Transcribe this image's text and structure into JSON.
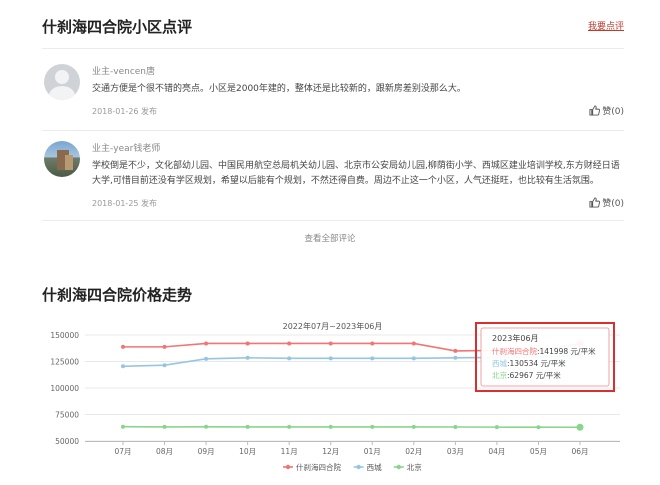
{
  "reviews_section": {
    "title": "什刹海四合院小区点评",
    "write_review_link": "我要点评",
    "reviews": [
      {
        "name": "业主-vencen唐",
        "text": "交通方便是个很不错的亮点。小区是2000年建的，整体还是比较新的，跟新房差别没那么大。",
        "date": "2018-01-26 发布",
        "like_label": "赞(0)"
      },
      {
        "name": "业主-year钱老师",
        "text": "学校倒是不少，文化部幼儿园、中国民用航空总局机关幼儿园、北京市公安局幼儿园,柳荫街小学、西城区建业培训学校,东方财经日语大学,可惜目前还没有学区规划，希望以后能有个规划，不然还得自费。周边不止这一个小区，人气还挺旺，也比较有生活氛围。",
        "date": "2018-01-25 发布",
        "like_label": "赞(0)"
      }
    ],
    "view_all": "查看全部评论"
  },
  "price_section": {
    "title": "什刹海四合院价格走势"
  },
  "chart_data": {
    "type": "line",
    "title": "2022年07月~2023年06月",
    "categories": [
      "07月",
      "08月",
      "09月",
      "10月",
      "11月",
      "12月",
      "01月",
      "02月",
      "03月",
      "04月",
      "05月",
      "06月"
    ],
    "yticks": [
      "150000",
      "125000",
      "100000",
      "75000",
      "50000"
    ],
    "ylim": [
      50000,
      150000
    ],
    "grid": true,
    "legend_position": "bottom",
    "series": [
      {
        "name": "什刹海四合院",
        "color": "#f27474",
        "values": [
          138800,
          138800,
          142000,
          142000,
          142000,
          142000,
          142000,
          142000,
          135000,
          135500,
          135500,
          141998
        ]
      },
      {
        "name": "西城",
        "color": "#94c6e4",
        "values": [
          120500,
          121500,
          127500,
          128500,
          128000,
          128000,
          128000,
          128000,
          128500,
          128800,
          129200,
          130534
        ]
      },
      {
        "name": "北京",
        "color": "#88d68c",
        "values": [
          63500,
          63300,
          63400,
          63300,
          63300,
          63300,
          63300,
          63300,
          63200,
          63100,
          63000,
          62967
        ]
      }
    ],
    "tooltip": {
      "title": "2023年06月",
      "rows": [
        {
          "name": "什刹海四合院",
          "value": "141998 元/平米"
        },
        {
          "name": "西城",
          "value": "130534 元/平米"
        },
        {
          "name": "北京",
          "value": "62967 元/平米"
        }
      ],
      "highlight_color": "#d9302f"
    }
  }
}
